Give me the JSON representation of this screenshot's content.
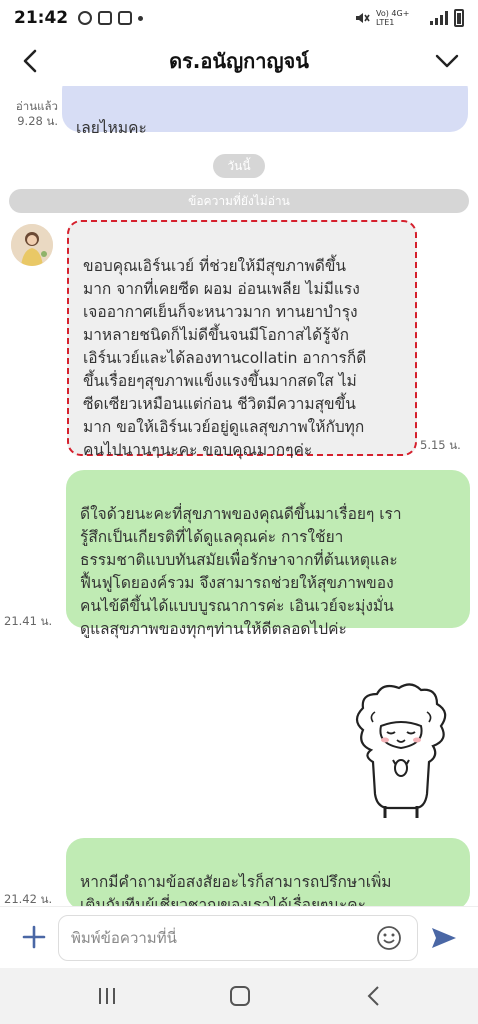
{
  "status_bar": {
    "time": "21:42",
    "network": "Vo) 4G+ LTE1"
  },
  "header": {
    "title": "ดร.อนัญกาญจน์"
  },
  "chat": {
    "previous_message": {
      "text": "เลยไหมคะ",
      "read_label": "อ่านแล้ว",
      "time": "9.28 น."
    },
    "date_label": "วันนี้",
    "unread_label": "ข้อความที่ยังไม่อ่าน",
    "messages": [
      {
        "text": "ขอบคุณเอิร์นเวย์ ที่ช่วยให้มีสุขภาพดีขึ้น\nมาก จากที่เคยซีด ผอม อ่อนเพลีย ไม่มีแรง\nเจออากาศเย็นก็จะหนาวมาก ทานยาบำรุง\nมาหลายชนิดก็ไม่ดีขึ้นจนมีโอกาสได้รู้จัก\nเอิร์นเวย์และได้ลองทานcollatin อาการก็ดี\nขึ้นเรื่อยๆสุขภาพแข็งแรงขึ้นมากสดใส ไม่\nซีดเซียวเหมือนแต่ก่อน ชีวิตมีความสุขขึ้น\nมาก ขอให้เอิร์นเวย์อยู่ดูแลสุขภาพให้กับทุก\nคนไปนานๆนะคะ ขอบคุณมากๆค่ะ",
        "time": "5.15 น."
      },
      {
        "text": "ดีใจด้วยนะคะที่สุขภาพของคุณดีขึ้นมาเรื่อยๆ เรา\nรู้สึกเป็นเกียรติที่ได้ดูแลคุณค่ะ การใช้ยา\nธรรมชาติแบบทันสมัยเพื่อรักษาจากที่ต้นเหตุและ\nฟื้นฟูโดยองค์รวม จึงสามารถช่วยให้สุขภาพของ\nคนไข้ดีขึ้นได้แบบบูรณาการค่ะ เอินเวย์จะมุ่งมั่น\nดูแลสุขภาพของทุกๆท่านให้ดีตลอดไปค่ะ",
        "time": "21.41 น."
      },
      {
        "text": "หากมีคำถามข้อสงสัยอะไรก็สามารถปรึกษาเพิ่ม\nเติมกับทีมผู้เชี่ยวชาญของเราได้เรื่อยๆนะคะ",
        "time": "21.42 น."
      }
    ]
  },
  "input": {
    "placeholder": "พิมพ์ข้อความที่นี่"
  },
  "icons": {
    "back": "back-arrow-icon",
    "dropdown": "chevron-down-icon",
    "plus": "plus-icon",
    "emoji": "emoji-icon",
    "send": "send-icon"
  },
  "colors": {
    "sent_bubble": "#c0ebb4",
    "received_bubble": "#efefef",
    "highlight_border": "#d5202d",
    "previous_bubble": "#d7ddf5"
  }
}
